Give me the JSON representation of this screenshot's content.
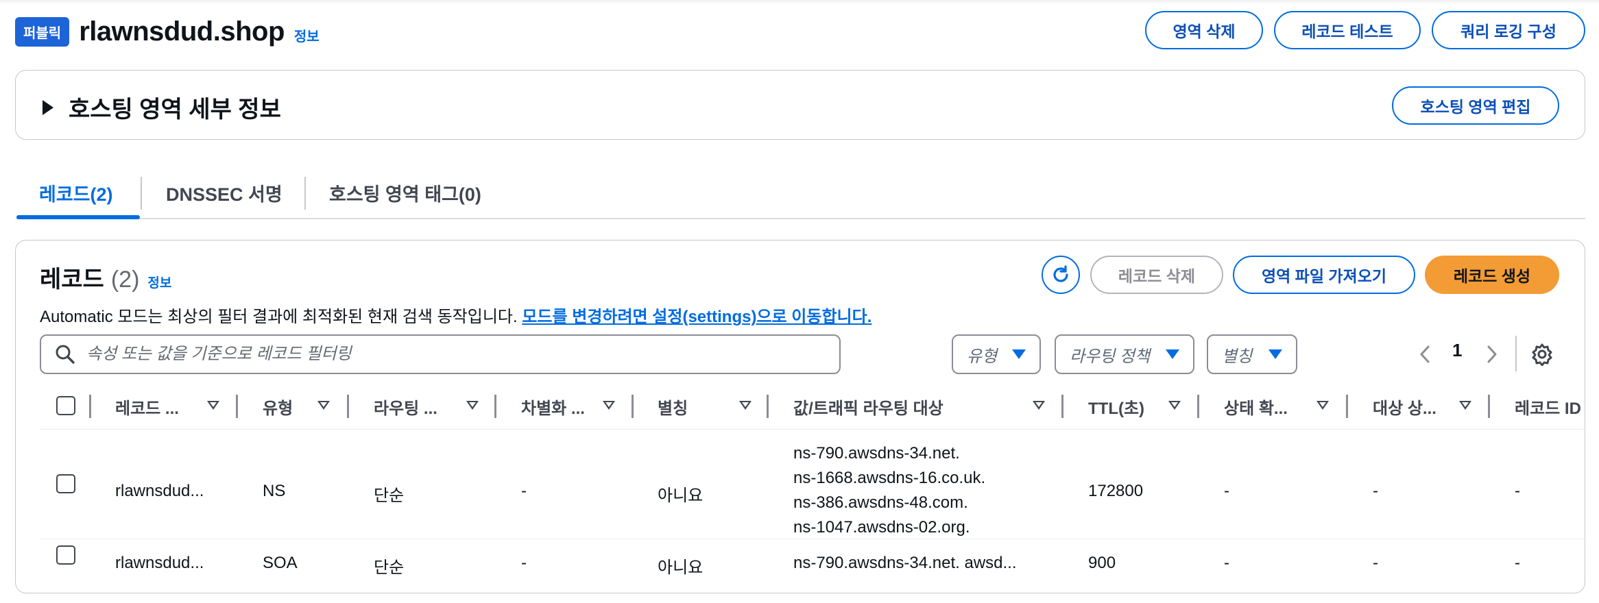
{
  "header": {
    "badge": "퍼블릭",
    "title": "rlawnsdud.shop",
    "info": "정보",
    "buttons": {
      "delete_zone": "영역 삭제",
      "test_record": "레코드 테스트",
      "query_logging": "쿼리 로깅 구성"
    }
  },
  "details": {
    "title": "호스팅 영역 세부 정보",
    "edit_button": "호스팅 영역 편집"
  },
  "tabs": [
    {
      "label": "레코드(2)",
      "active": true
    },
    {
      "label": "DNSSEC 서명",
      "active": false
    },
    {
      "label": "호스팅 영역 태그(0)",
      "active": false
    }
  ],
  "records": {
    "title": "레코드",
    "count": "(2)",
    "info": "정보",
    "actions": {
      "delete": "레코드 삭제",
      "import": "영역 파일 가져오기",
      "create": "레코드 생성"
    },
    "description": "Automatic 모드는 최상의 필터 결과에 최적화된 현재 검색 동작입니다.",
    "description_link": "모드를 변경하려면 설정(settings)으로 이동합니다.",
    "search_placeholder": "속성 또는 값을 기준으로 레코드 필터링",
    "filters": {
      "type": "유형",
      "routing": "라우팅 정책",
      "alias": "별칭"
    },
    "pagination": {
      "page": "1"
    },
    "columns": {
      "name": "레코드 ...",
      "type": "유형",
      "routing": "라우팅 ...",
      "diff": "차별화 ...",
      "alias": "별칭",
      "value": "값/트래픽 라우팅 대상",
      "ttl": "TTL(초)",
      "health": "상태 확...",
      "target": "대상 상...",
      "record_id": "레코드 ID"
    },
    "rows": [
      {
        "name": "rlawnsdud...",
        "type": "NS",
        "routing": "단순",
        "diff": "-",
        "alias": "아니요",
        "values": [
          "ns-790.awsdns-34.net.",
          "ns-1668.awsdns-16.co.uk.",
          "ns-386.awsdns-48.com.",
          "ns-1047.awsdns-02.org."
        ],
        "ttl": "172800",
        "health": "-",
        "target": "-",
        "record_id": "-"
      },
      {
        "name": "rlawnsdud...",
        "type": "SOA",
        "routing": "단순",
        "diff": "-",
        "alias": "아니요",
        "values": [
          "ns-790.awsdns-34.net. awsd..."
        ],
        "ttl": "900",
        "health": "-",
        "target": "-",
        "record_id": "-"
      }
    ]
  },
  "colors": {
    "accent": "#006ce0",
    "primary_button": "#f39b34",
    "badge": "#1d64d8"
  }
}
